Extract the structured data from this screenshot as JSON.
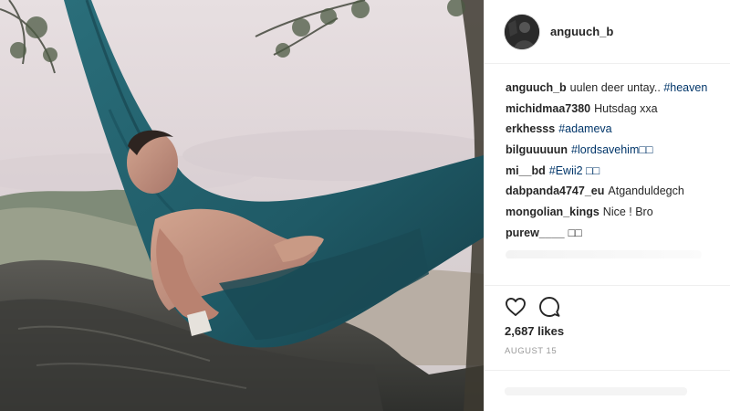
{
  "post": {
    "username": "anguuch_b",
    "likes": "2,687 likes",
    "date": "AUGUST 15"
  },
  "comments": [
    {
      "user": "anguuch_b",
      "text": "uulen deer untay..",
      "tag": "#heaven"
    },
    {
      "user": "michidmaa7380",
      "text": "Hutsdag xxa",
      "tag": ""
    },
    {
      "user": "erkhesss",
      "text": "",
      "tag": "#adameva"
    },
    {
      "user": "bilguuuuun",
      "text": "",
      "tag": "#lordsavehim□□"
    },
    {
      "user": "mi__bd",
      "text": "",
      "tag": "#Ewii2 □□"
    },
    {
      "user": "dabpanda4747_eu",
      "text": "Atganduldegch",
      "tag": ""
    },
    {
      "user": "mongolian_kings",
      "text": "Nice ! Bro",
      "tag": ""
    },
    {
      "user": "purew____",
      "text": "□□",
      "tag": ""
    }
  ],
  "icons": {
    "like": "heart-outline-icon",
    "comment": "speech-bubble-icon"
  },
  "colors": {
    "hashtag": "#003569",
    "hammock": "#1f5a66",
    "secondary_text": "#999999"
  }
}
